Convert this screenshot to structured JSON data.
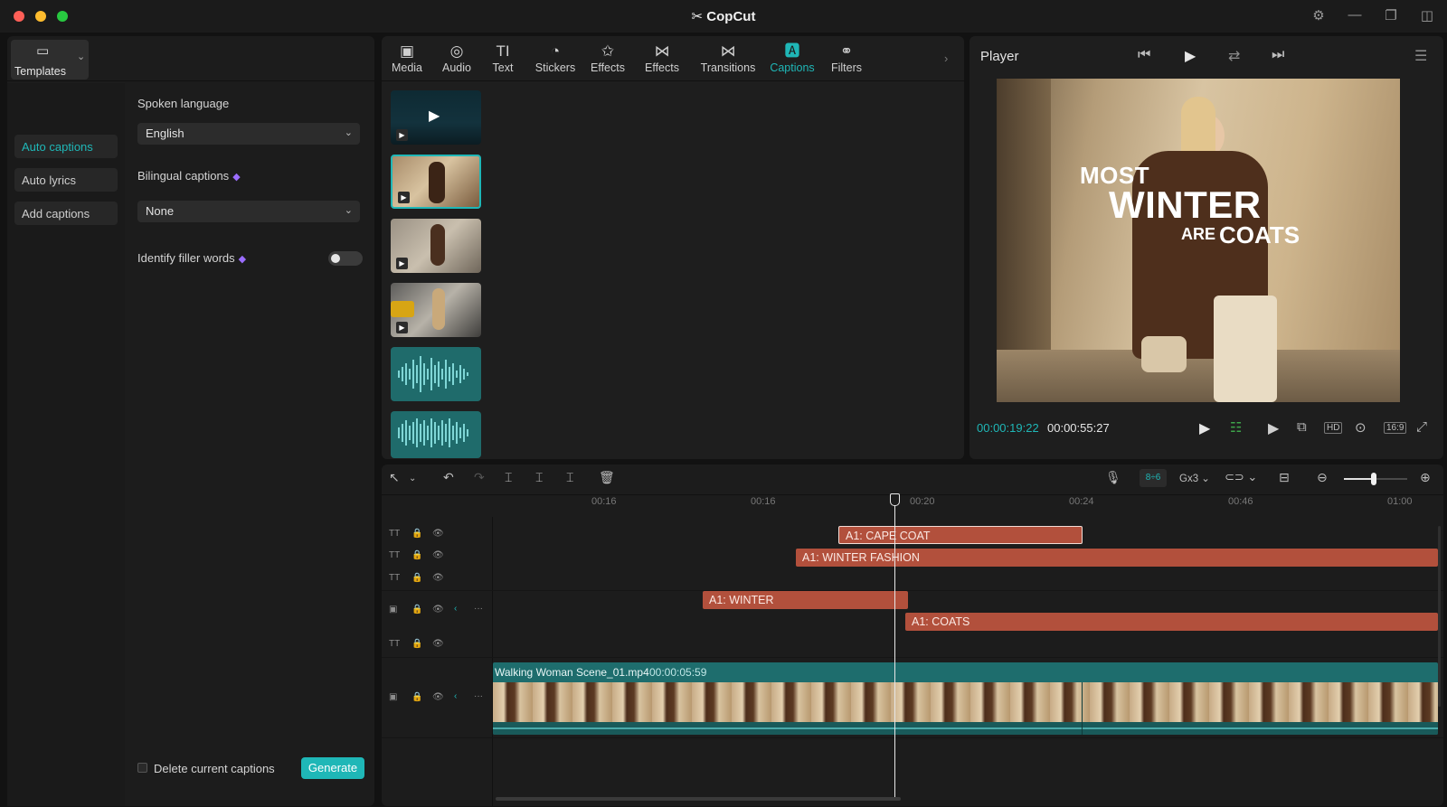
{
  "app": {
    "title": "CopCut"
  },
  "colors": {
    "accent": "#1fb7b7",
    "clip": "#b2503c",
    "video_track": "#1e6d6d",
    "gem": "#9b6dff"
  },
  "left_panel": {
    "templates_label": "Templates",
    "sub_tabs": [
      {
        "label": "Auto captions",
        "active": true
      },
      {
        "label": "Auto lyrics",
        "active": false
      },
      {
        "label": "Add captions",
        "active": false
      }
    ],
    "spoken_language": {
      "label": "Spoken language",
      "value": "English"
    },
    "bilingual": {
      "label": "Bilingual captions",
      "value": "None"
    },
    "filler": {
      "label": "Identify filler words",
      "on": false
    },
    "delete_label": "Delete current captions",
    "generate_label": "Generate"
  },
  "toolbar": {
    "tools": [
      {
        "label": "Media",
        "icon": "media-icon"
      },
      {
        "label": "Audio",
        "icon": "audio-icon"
      },
      {
        "label": "Text",
        "icon": "text-icon"
      },
      {
        "label": "Stickers",
        "icon": "stickers-icon"
      },
      {
        "label": "Effects",
        "icon": "effects-icon"
      },
      {
        "label": "Effects",
        "icon": "effects-icon"
      },
      {
        "label": "Transitions",
        "icon": "transitions-icon"
      },
      {
        "label": "Captions",
        "icon": "captions-icon"
      },
      {
        "label": "Filters",
        "icon": "filters-icon"
      }
    ]
  },
  "player": {
    "title": "Player",
    "current_time": "00:00:19:22",
    "total_time": "00:00:55:27",
    "overlay": {
      "line1": "MOST",
      "line2": "WINTER",
      "line3a": "ARE",
      "line3b": "COATS"
    }
  },
  "timeline": {
    "tools_right": {
      "link": "8÷6",
      "speed": "Gx3"
    },
    "ticks": [
      "00:16",
      "00:16",
      "00:20",
      "00:24",
      "00:46",
      "01:00"
    ],
    "clips": [
      "A1: CAPE COAT",
      "A1: WINTER FASHION",
      "A1: WINTER",
      "A1: COATS"
    ],
    "video": {
      "name": "Walking Woman Scene_01.mp4",
      "duration": "00:00:05:59"
    }
  }
}
